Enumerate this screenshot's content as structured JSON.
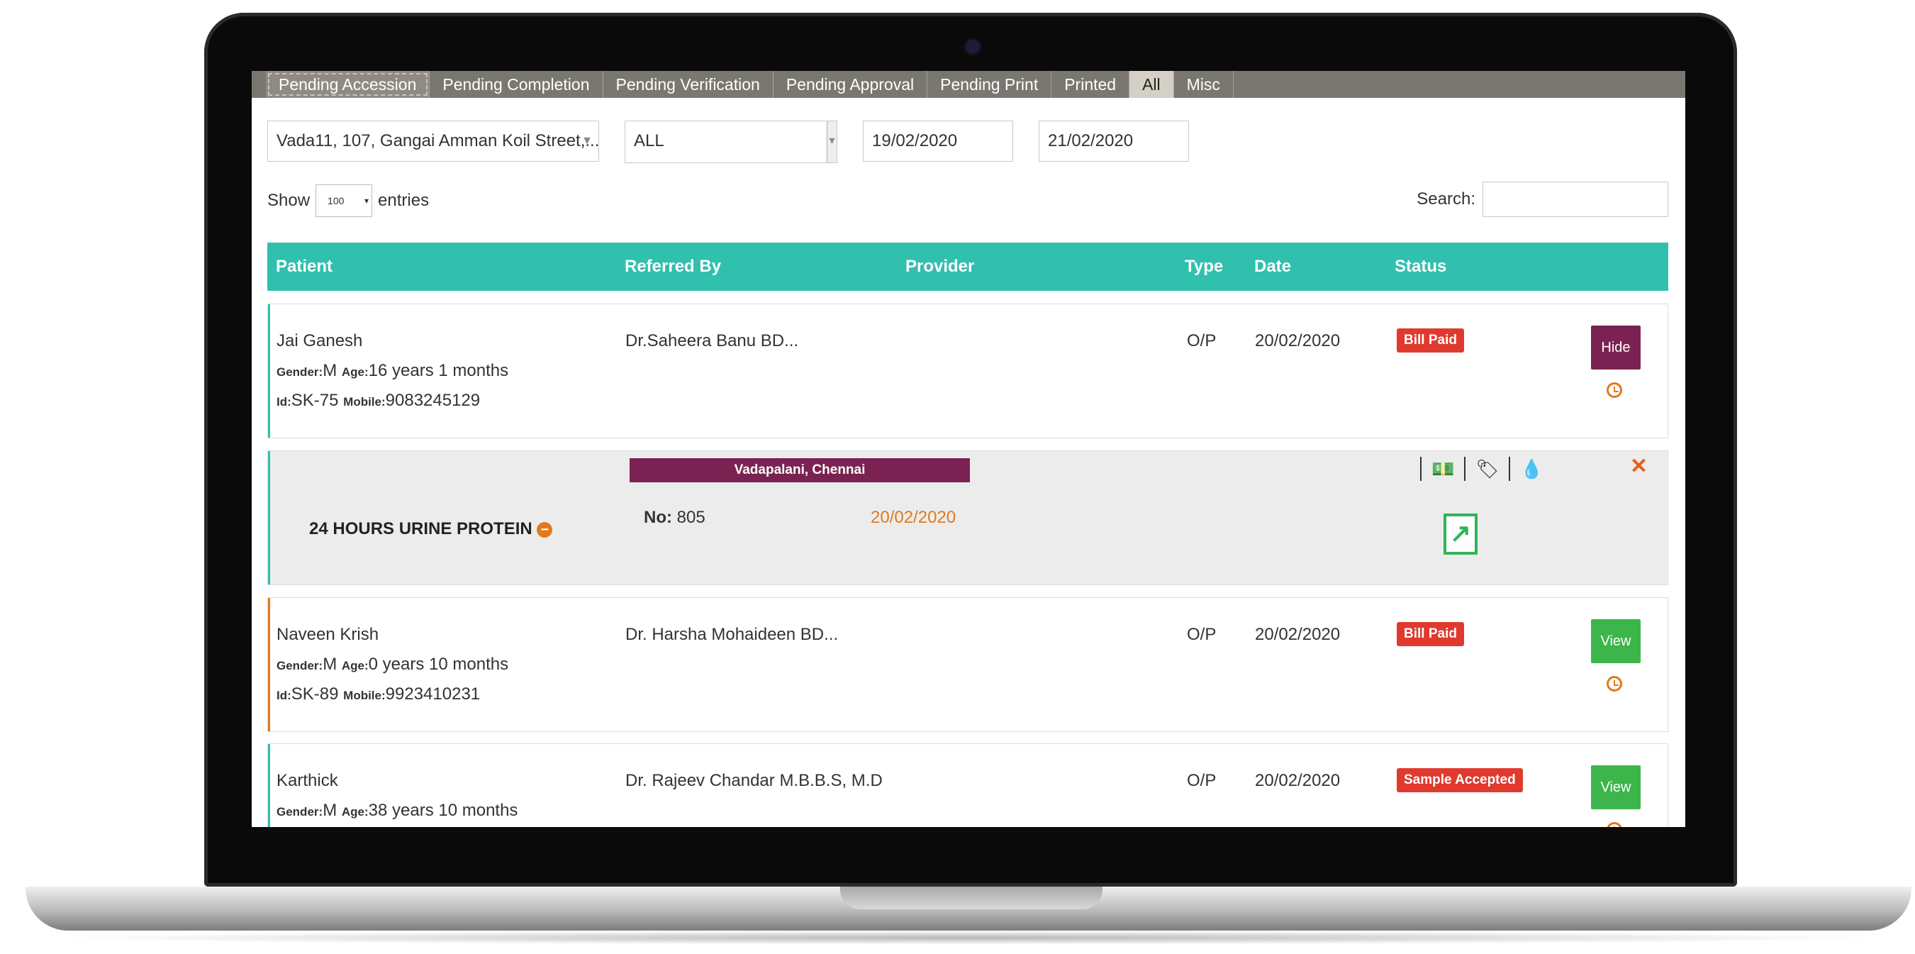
{
  "tabs": [
    {
      "label": "Pending Accession"
    },
    {
      "label": "Pending Completion"
    },
    {
      "label": "Pending Verification"
    },
    {
      "label": "Pending Approval"
    },
    {
      "label": "Pending Print"
    },
    {
      "label": "Printed"
    },
    {
      "label": "All"
    },
    {
      "label": "Misc"
    }
  ],
  "filters": {
    "location": "Vada11, 107, Gangai Amman Koil Street,...",
    "type": "ALL",
    "from_date": "19/02/2020",
    "to_date": "21/02/2020"
  },
  "table_controls": {
    "show_label": "Show",
    "entries_value": "100",
    "entries_label": "entries",
    "search_label": "Search:"
  },
  "columns": {
    "patient": "Patient",
    "referred_by": "Referred By",
    "provider": "Provider",
    "type": "Type",
    "date": "Date",
    "status": "Status"
  },
  "rows": [
    {
      "name": "Jai Ganesh",
      "gender_label": "Gender:",
      "gender": "M",
      "age_label": "Age:",
      "age": "16 years 1 months",
      "id_label": "Id:",
      "id": "SK-75",
      "mobile_label": "Mobile:",
      "mobile": "9083245129",
      "referred_by": "Dr.Saheera Banu BD...",
      "type": "O/P",
      "date": "20/02/2020",
      "status": "Bill Paid",
      "action": "Hide"
    },
    {
      "name": "Naveen Krish",
      "gender_label": "Gender:",
      "gender": "M",
      "age_label": "Age:",
      "age": "0 years 10 months",
      "id_label": "Id:",
      "id": "SK-89",
      "mobile_label": "Mobile:",
      "mobile": "9923410231",
      "referred_by": "Dr. Harsha Mohaideen BD...",
      "type": "O/P",
      "date": "20/02/2020",
      "status": "Bill Paid",
      "action": "View"
    },
    {
      "name": "Karthick",
      "gender_label": "Gender:",
      "gender": "M",
      "age_label": "Age:",
      "age": "38 years 10 months",
      "referred_by": "Dr. Rajeev Chandar M.B.B.S, M.D",
      "type": "O/P",
      "date": "20/02/2020",
      "status": "Sample Accepted",
      "action": "View"
    }
  ],
  "detail": {
    "test_name": "24 HOURS URINE PROTEIN",
    "location": "Vadapalani, Chennai",
    "no_label": "No:",
    "no": "805",
    "date": "20/02/2020"
  },
  "colors": {
    "header": "#31bfae",
    "bill_paid": "#e03a2f",
    "hide_button": "#7a2352",
    "view_button": "#3cb54a",
    "accent_orange": "#e07a1c"
  }
}
